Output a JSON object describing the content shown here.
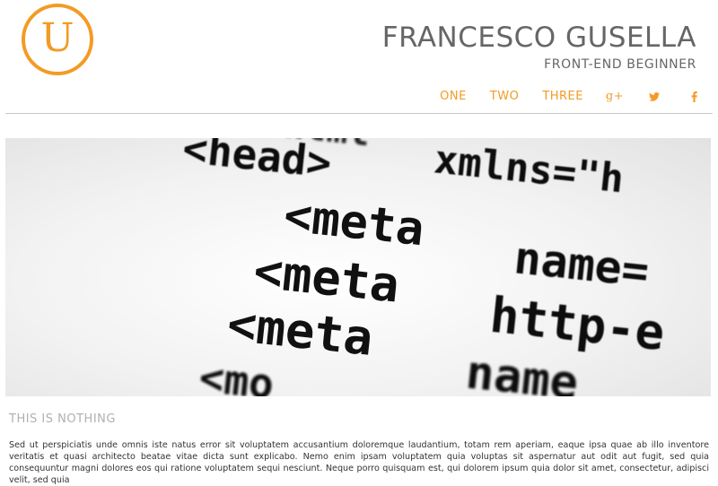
{
  "logo": {
    "letter": "U"
  },
  "header": {
    "title": "FRANCESCO GUSELLA",
    "subtitle": "FRONT-END BEGINNER"
  },
  "nav": {
    "items": [
      {
        "label": "ONE"
      },
      {
        "label": "TWO"
      },
      {
        "label": "THREE"
      }
    ],
    "social": [
      "google-plus-icon",
      "twitter-icon",
      "facebook-icon"
    ],
    "gplus_label": "g+"
  },
  "hero": {
    "lines": [
      "<html",
      "<head>",
      "xmlns=\"h",
      "<meta",
      "name=",
      "<meta",
      "http-e",
      "<meta",
      "name",
      "<mo"
    ]
  },
  "section": {
    "title": "THIS IS NOTHING"
  },
  "content": {
    "paragraph": "Sed ut perspiciatis unde omnis iste natus error sit voluptatem accusantium doloremque laudantium, totam rem aperiam, eaque ipsa quae ab illo inventore veritatis et quasi architecto beatae vitae dicta sunt explicabo. Nemo enim ipsam voluptatem quia voluptas sit aspernatur aut odit aut fugit, sed quia consequuntur magni dolores eos qui ratione voluptatem sequi nesciunt. Neque porro quisquam est, qui dolorem ipsum quia dolor sit amet, consectetur, adipisci velit, sed quia"
  },
  "colors": {
    "accent": "#f39b25",
    "text": "#666666",
    "muted": "#b0b0b0"
  }
}
